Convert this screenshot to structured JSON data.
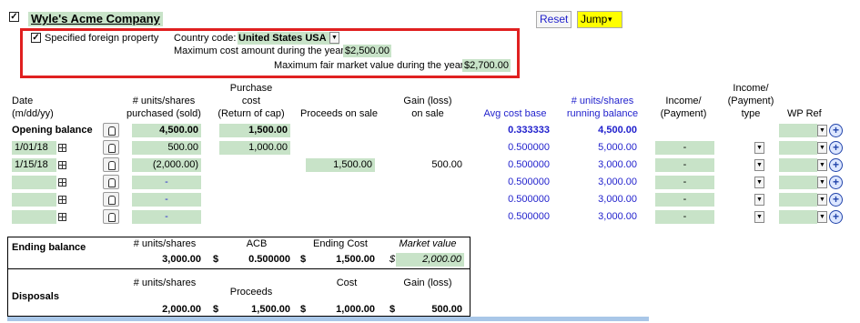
{
  "company": {
    "checked": "✓",
    "name": "Wyle's Acme Company"
  },
  "toolbar": {
    "reset": "Reset",
    "jump": "Jump",
    "jump_arrow": "▾"
  },
  "foreign": {
    "checked": "✓",
    "label": "Specified foreign property",
    "country_label": "Country code:",
    "country_value": "United States USA",
    "max_cost_label": "Maximum cost amount during the year:",
    "max_cost_value": "$2,500.00",
    "max_fmv_label": "Maximum fair market value during the year:",
    "max_fmv_value": "$2,700.00"
  },
  "headers": {
    "date": [
      "Date",
      "(m/dd/yy)"
    ],
    "units": [
      "# units/shares",
      "purchased (sold)"
    ],
    "cost": [
      "Purchase",
      "cost",
      "(Return of cap)"
    ],
    "proceeds": "Proceeds on sale",
    "gain": [
      "Gain (loss)",
      "on sale"
    ],
    "avg": "Avg cost base",
    "running": [
      "# units/shares",
      "running balance"
    ],
    "income": [
      "Income/",
      "(Payment)"
    ],
    "income_type": [
      "Income/",
      "(Payment)",
      "type"
    ],
    "wp": "WP Ref"
  },
  "rows": [
    {
      "date": "Opening balance",
      "units": "4,500.00",
      "cost": "1,500.00",
      "proceeds": "",
      "gain": "",
      "avg": "0.333333",
      "running": "4,500.00",
      "income": ""
    },
    {
      "date": "1/01/18",
      "units": "500.00",
      "cost": "1,000.00",
      "proceeds": "",
      "gain": "",
      "avg": "0.500000",
      "running": "5,000.00",
      "income": "-"
    },
    {
      "date": "1/15/18",
      "units": "(2,000.00)",
      "cost": "",
      "proceeds": "1,500.00",
      "gain": "500.00",
      "avg": "0.500000",
      "running": "3,000.00",
      "income": "-"
    },
    {
      "date": "",
      "units": "-",
      "cost": "",
      "proceeds": "",
      "gain": "",
      "avg": "0.500000",
      "running": "3,000.00",
      "income": "-"
    },
    {
      "date": "",
      "units": "-",
      "cost": "",
      "proceeds": "",
      "gain": "",
      "avg": "0.500000",
      "running": "3,000.00",
      "income": "-"
    },
    {
      "date": "",
      "units": "-",
      "cost": "",
      "proceeds": "",
      "gain": "",
      "avg": "0.500000",
      "running": "3,000.00",
      "income": "-"
    }
  ],
  "ending": {
    "label": "Ending balance",
    "units_label": "# units/shares",
    "acb_label": "ACB",
    "cost_label": "Ending Cost",
    "mv_label": "Market value",
    "units": "3,000.00",
    "dollar": "$",
    "acb": "0.500000",
    "cost": "1,500.00",
    "mv": "2,000.00"
  },
  "disposals": {
    "label": "Disposals",
    "units_label": "# units/shares",
    "proceeds_label": "Proceeds",
    "cost_label": "Cost",
    "gain_label": "Gain (loss)",
    "units": "2,000.00",
    "dollar": "$",
    "proceeds": "1,500.00",
    "cost": "1,000.00",
    "gain": "500.00"
  },
  "icons": {
    "calculator": "calculator-icon",
    "calendar": "calendar-icon",
    "dropdown": "dropdown-arrow-icon",
    "add": "add-circle-icon"
  },
  "colors": {
    "input_fill": "#c8e3c8",
    "highlight_border": "#e02020",
    "jump_bg": "#ffff00",
    "blue_text": "#1f1fcc"
  }
}
